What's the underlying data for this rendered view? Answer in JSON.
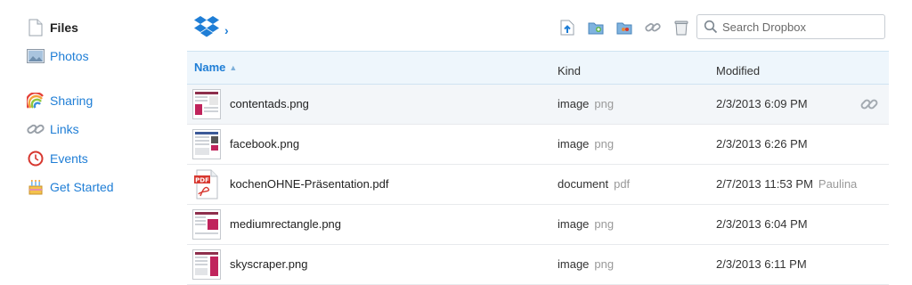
{
  "sidebar": {
    "items": [
      {
        "label": "Files"
      },
      {
        "label": "Photos"
      },
      {
        "label": "Sharing"
      },
      {
        "label": "Links"
      },
      {
        "label": "Events"
      },
      {
        "label": "Get Started"
      }
    ]
  },
  "breadcrumb": {
    "arrow": "›"
  },
  "toolbar": {
    "icons": [
      "upload-icon",
      "new-folder-icon",
      "shared-folder-icon",
      "get-link-icon",
      "deleted-files-icon"
    ]
  },
  "search": {
    "placeholder": "Search Dropbox",
    "value": ""
  },
  "table": {
    "columns": {
      "name": "Name",
      "sort": "▲",
      "kind": "Kind",
      "modified": "Modified"
    },
    "rows": [
      {
        "name": "contentads.png",
        "kind": "image",
        "ext": "png",
        "modified": "2/3/2013 6:09 PM",
        "by": ""
      },
      {
        "name": "facebook.png",
        "kind": "image",
        "ext": "png",
        "modified": "2/3/2013 6:26 PM",
        "by": ""
      },
      {
        "name": "kochenOHNE-Präsentation.pdf",
        "kind": "document",
        "ext": "pdf",
        "modified": "2/7/2013 11:53 PM",
        "by": "Paulina"
      },
      {
        "name": "mediumrectangle.png",
        "kind": "image",
        "ext": "png",
        "modified": "2/3/2013 6:04 PM",
        "by": ""
      },
      {
        "name": "skyscraper.png",
        "kind": "image",
        "ext": "png",
        "modified": "2/3/2013 6:11 PM",
        "by": ""
      }
    ]
  },
  "colors": {
    "link": "#1f7ed6",
    "header_bg": "#eef6fc",
    "dropbox_blue": "#1f7ed6"
  }
}
